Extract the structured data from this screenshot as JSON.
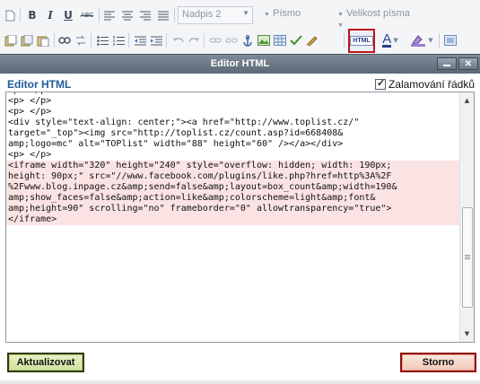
{
  "toolbar": {
    "row1": {
      "bold": "B",
      "italic": "I",
      "underline": "U",
      "strike": "ABC",
      "format_select": "Nadpis 2",
      "font_select": "Písmo",
      "size_select": "Velikost písma"
    },
    "row2": {
      "html_button": "HTML",
      "text_color": "A"
    }
  },
  "dialog": {
    "title": "Editor HTML",
    "heading": "Editor HTML",
    "wrap_label": "Zalamování řádků",
    "wrap_checked": true,
    "code_lines": [
      {
        "text": "<p> </p>",
        "hl": false
      },
      {
        "text": "<p> </p>",
        "hl": false
      },
      {
        "text": "<p> </p>",
        "hl": false
      },
      {
        "text": "<div style=\"text-align: center;\"><a href=\"http://www.toplist.cz/\"",
        "hl": false
      },
      {
        "text": "target=\"_top\"><img src=\"http://toplist.cz/count.asp?id=668408&",
        "hl": false
      },
      {
        "text": "amp;logo=mc\" alt=\"TOPlist\" width=\"88\" height=\"60\" /></a></div>",
        "hl": false
      },
      {
        "text": "<p> </p>",
        "hl": false
      },
      {
        "text": "<iframe width=\"320\" height=\"240\" style=\"overflow: hidden; width: 190px;",
        "hl": true
      },
      {
        "text": "height: 90px;\" src=\"//www.facebook.com/plugins/like.php?href=http%3A%2F",
        "hl": true
      },
      {
        "text": "%2Fwww.blog.inpage.cz&amp;send=false&amp;layout=box_count&amp;width=190&",
        "hl": true
      },
      {
        "text": "amp;show_faces=false&amp;action=like&amp;colorscheme=light&amp;font&",
        "hl": true
      },
      {
        "text": "amp;height=90\" scrolling=\"no\" frameborder=\"0\" allowtransparency=\"true\">",
        "hl": true
      },
      {
        "text": "</iframe>",
        "hl": true
      }
    ],
    "ok_button": "Aktualizovat",
    "cancel_button": "Storno"
  },
  "colors": {
    "heading": "#1f5c9a",
    "highlight": "#fbe3e4",
    "html_button_border": "#c0151b"
  }
}
